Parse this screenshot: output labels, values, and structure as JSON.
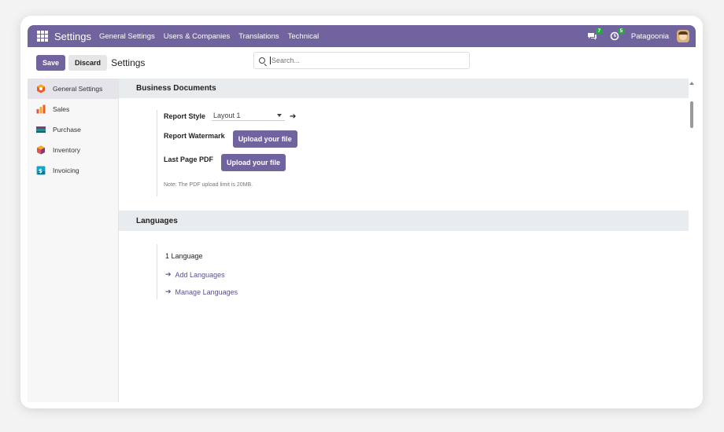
{
  "topnav": {
    "brand": "Settings",
    "menu": [
      "General Settings",
      "Users & Companies",
      "Translations",
      "Technical"
    ],
    "messages_badge": "7",
    "activities_badge": "5",
    "company": "Patagoonia"
  },
  "control_panel": {
    "save_label": "Save",
    "discard_label": "Discard",
    "title": "Settings",
    "search_placeholder": "Search..."
  },
  "sidebar": {
    "items": [
      {
        "label": "General Settings",
        "icon": "general-settings-icon",
        "color": "#f15a24"
      },
      {
        "label": "Sales",
        "icon": "sales-icon",
        "color": "#f7a721"
      },
      {
        "label": "Purchase",
        "icon": "purchase-icon",
        "color": "#2a8b8e"
      },
      {
        "label": "Inventory",
        "icon": "inventory-icon",
        "color": "#e8524a"
      },
      {
        "label": "Invoicing",
        "icon": "invoicing-icon",
        "color": "#1aa3c8"
      }
    ]
  },
  "business_documents": {
    "heading": "Business Documents",
    "report_style_label": "Report Style",
    "report_style_value": "Layout 1",
    "report_watermark_label": "Report Watermark",
    "upload_label": "Upload your file",
    "last_page_pdf_label": "Last Page PDF",
    "note": "Note: The PDF upload limit is 20MB."
  },
  "languages": {
    "heading": "Languages",
    "count": "1 Language",
    "add_link": "Add Languages",
    "manage_link": "Manage Languages"
  },
  "colors": {
    "brand": "#71639e",
    "section_bg": "#e9ecef",
    "link": "#5d4f8e"
  }
}
